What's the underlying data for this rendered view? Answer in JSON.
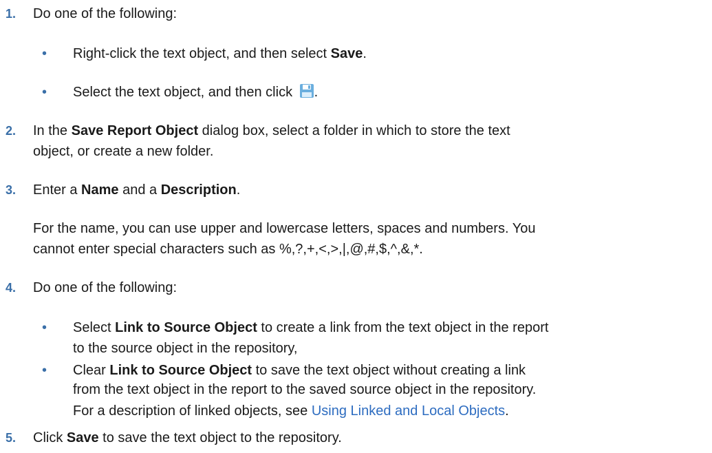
{
  "steps": [
    {
      "number": "1.",
      "text": "Do one of the following:"
    },
    {
      "number": "2.",
      "line1_a": "In the ",
      "line1_bold": "Save Report Object",
      "line1_b": " dialog box, select a folder in which to store the text",
      "line2": "object, or create a new folder."
    },
    {
      "number": "3.",
      "a": "Enter a ",
      "bold1": "Name",
      "b": " and a ",
      "bold2": "Description",
      "c": ".",
      "note_line1": "For the name, you can use upper and lowercase letters, spaces and numbers. You",
      "note_line2": "cannot enter special characters such as %,?,+,<,>,|,@,#,$,^,&,*."
    },
    {
      "number": "4.",
      "text": "Do one of the following:"
    },
    {
      "number": "5.",
      "a": "Click ",
      "bold": "Save",
      "b": " to save the text object to the repository."
    }
  ],
  "step1_bullets": [
    {
      "a": "Right-click the text object, and then select ",
      "bold": "Save",
      "b": "."
    },
    {
      "a": "Select the text object, and then click ",
      "icon": "save-icon",
      "b": "."
    }
  ],
  "step4_bullets": [
    {
      "a": "Select ",
      "bold": "Link to Source Object",
      "b": " to create a link from the text object in the report",
      "line2": "to the source object in the repository,"
    },
    {
      "a": "Clear ",
      "bold": "Link to Source Object",
      "b": " to save the text object without creating a link",
      "line2": "from the text object in the report to the saved source object in the repository."
    }
  ],
  "linked_note": {
    "a": "For a description of linked objects, see ",
    "link": "Using Linked and Local Objects",
    "b": "."
  },
  "bullet_char": "•",
  "colors": {
    "accent": "#3a6fa8",
    "link": "#2d6cc0",
    "text": "#1a1a1a"
  }
}
